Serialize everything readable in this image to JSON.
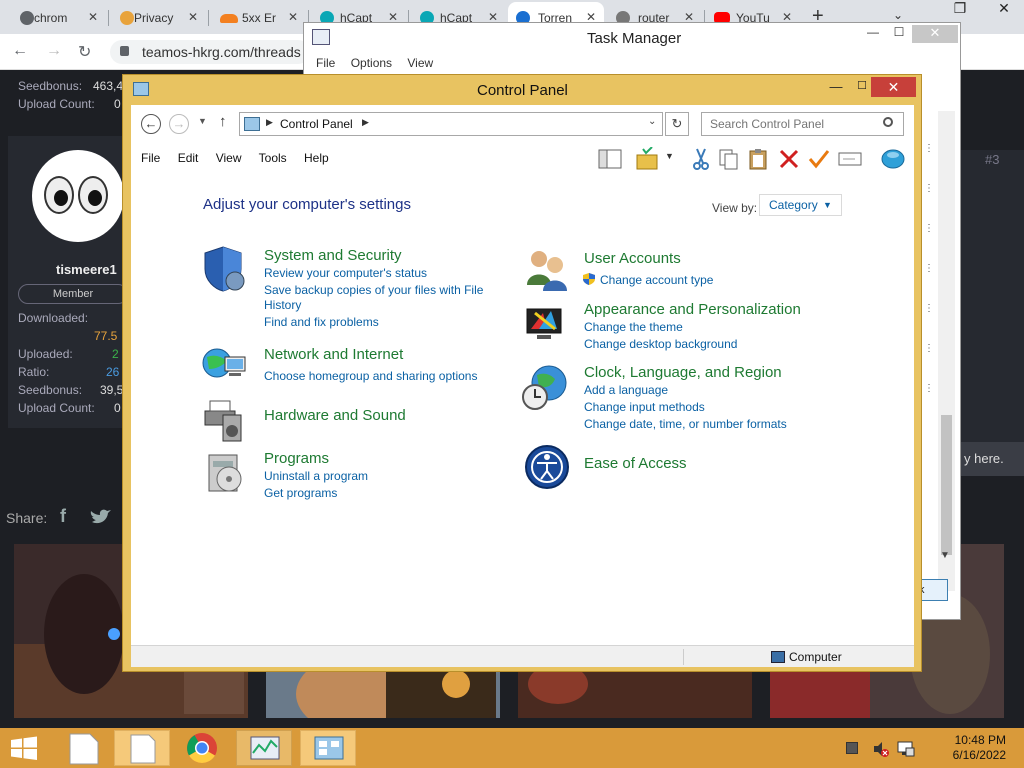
{
  "browser": {
    "tabs": [
      {
        "label": "chrom",
        "fav": "#5f6368"
      },
      {
        "label": "Privacy",
        "fav": "#e8a33c"
      },
      {
        "label": "5xx Er",
        "fav": "#f38020"
      },
      {
        "label": "hCapt",
        "fav": "#0aa7b5"
      },
      {
        "label": "hCapt",
        "fav": "#0aa7b5"
      },
      {
        "label": "Torren",
        "fav": "#1a6fd1"
      },
      {
        "label": "router",
        "fav": "#777"
      },
      {
        "label": "YouTu",
        "fav": "#ff0000"
      }
    ],
    "new_tab": "+",
    "url": "teamos-hkrg.com/threads"
  },
  "forum": {
    "top_stats": [
      {
        "label": "Seedbonus:",
        "value": "463,4"
      },
      {
        "label": "Upload Count:",
        "value": "0"
      }
    ],
    "username": "tismeere1",
    "role": "Member",
    "stats": [
      {
        "label": "Downloaded:",
        "value": ""
      },
      {
        "label": "",
        "value": "77.5"
      },
      {
        "label": "Uploaded:",
        "value": "2"
      },
      {
        "label": "Ratio:",
        "value": "26"
      },
      {
        "label": "Seedbonus:",
        "value": "39,5"
      },
      {
        "label": "Upload Count:",
        "value": "0"
      }
    ],
    "share_label": "Share:",
    "post_number": "#3",
    "reply_text": "y here."
  },
  "task_manager": {
    "title": "Task Manager",
    "menu": [
      "File",
      "Options",
      "View"
    ],
    "end_button": "k"
  },
  "control_panel": {
    "title": "Control Panel",
    "breadcrumb": "Control Panel",
    "search_placeholder": "Search Control Panel",
    "menu": [
      "File",
      "Edit",
      "View",
      "Tools",
      "Help"
    ],
    "heading": "Adjust your computer's settings",
    "view_by_label": "View by:",
    "view_by_value": "Category",
    "categories": [
      {
        "title": "System and Security",
        "icon": "shield-icon",
        "links": [
          "Review your computer's status",
          "Save backup copies of your files with File",
          "History",
          "Find and fix problems"
        ]
      },
      {
        "title": "Network and Internet",
        "icon": "network-icon",
        "links": [
          "Choose homegroup and sharing options"
        ]
      },
      {
        "title": "Hardware and Sound",
        "icon": "printer-speaker-icon",
        "links": []
      },
      {
        "title": "Programs",
        "icon": "programs-icon",
        "links": [
          "Uninstall a program",
          "Get programs"
        ]
      },
      {
        "title": "User Accounts",
        "icon": "users-icon",
        "links": [
          "Change account type"
        ]
      },
      {
        "title": "Appearance and Personalization",
        "icon": "monitor-paint-icon",
        "links": [
          "Change the theme",
          "Change desktop background"
        ]
      },
      {
        "title": "Clock, Language, and Region",
        "icon": "globe-clock-icon",
        "links": [
          "Add a language",
          "Change input methods",
          "Change date, time, or number formats"
        ]
      },
      {
        "title": "Ease of Access",
        "icon": "ease-of-access-icon",
        "links": []
      }
    ],
    "status_location": "Computer"
  },
  "taskbar": {
    "time": "10:48 PM",
    "date": "6/16/2022"
  }
}
